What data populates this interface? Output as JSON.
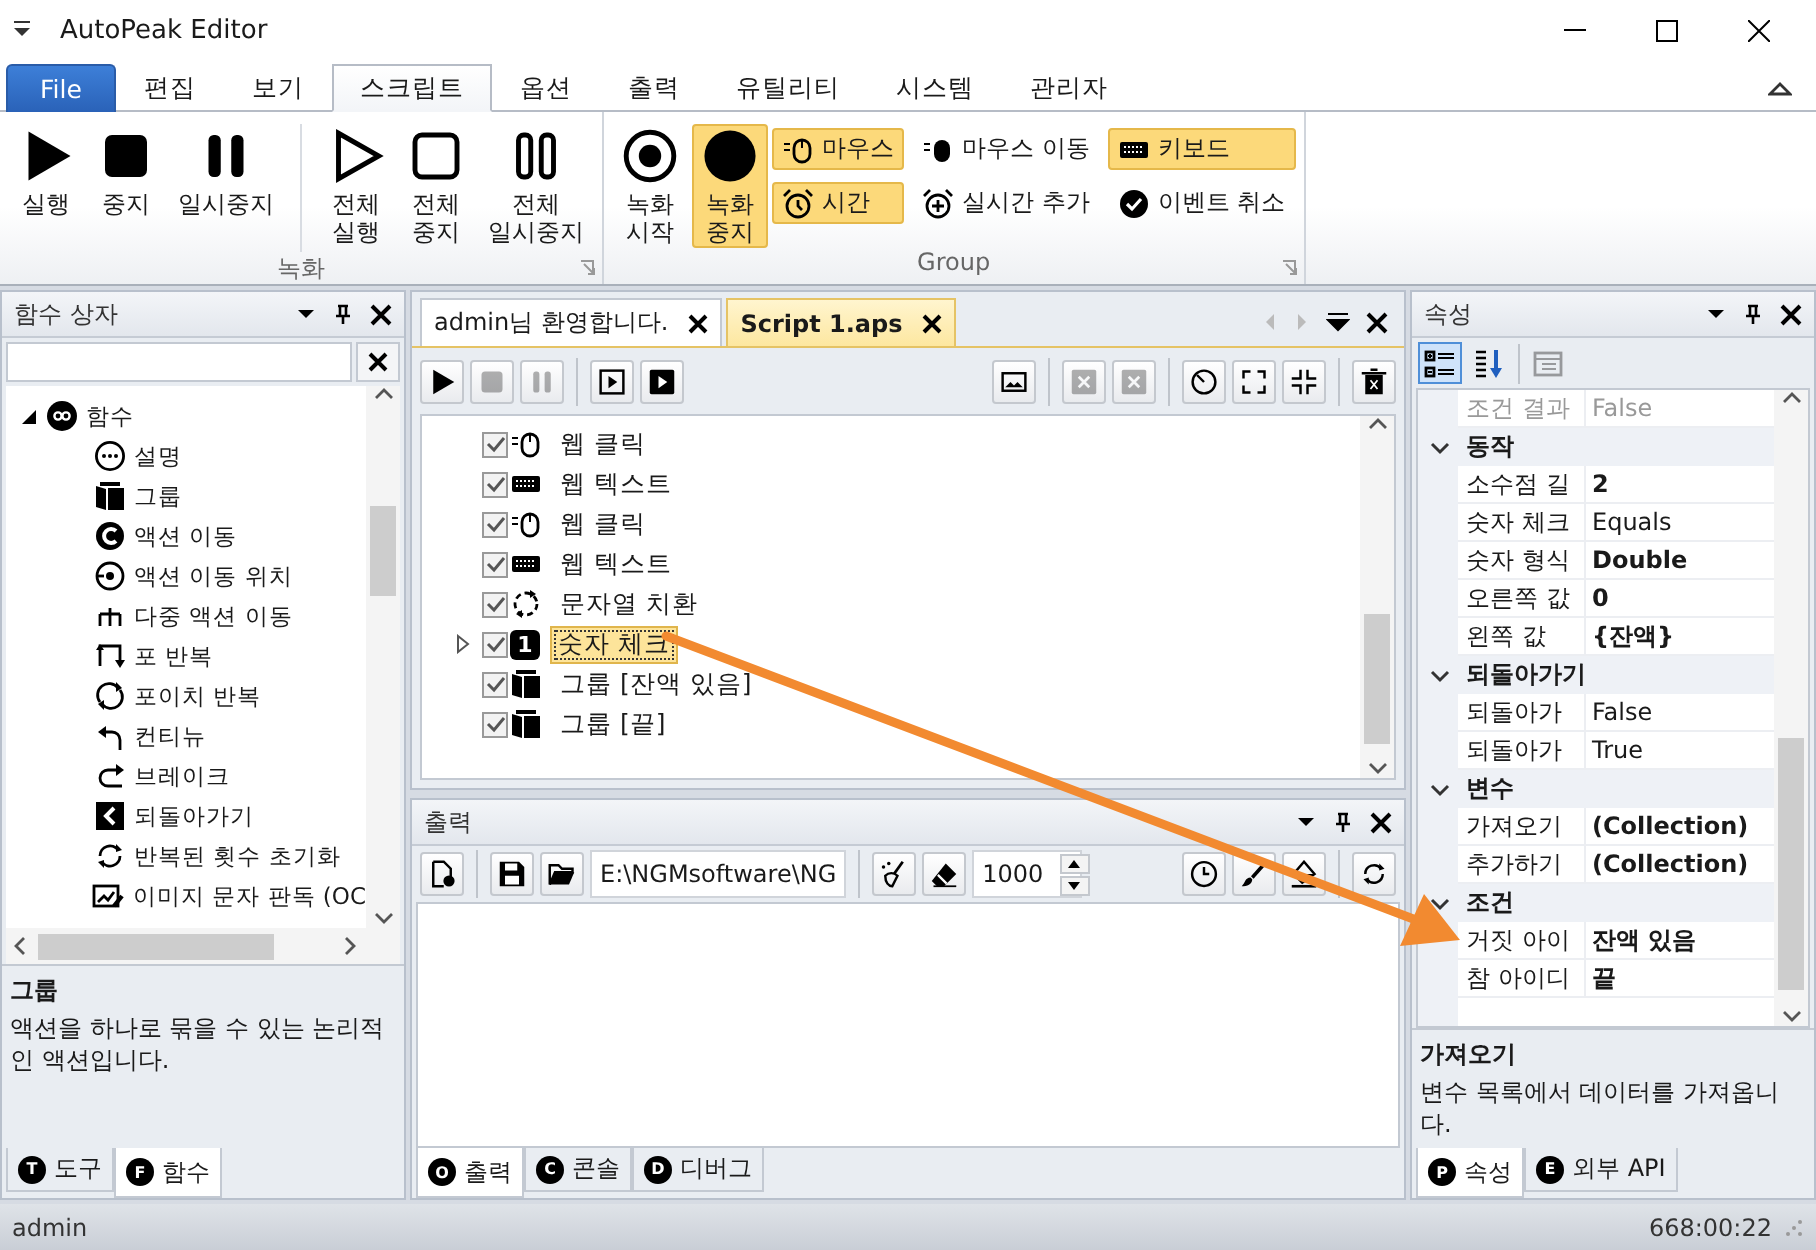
{
  "window": {
    "title": "AutoPeak Editor"
  },
  "ribbon_tabs": [
    {
      "label": "File",
      "kind": "file",
      "selected": false
    },
    {
      "label": "편집",
      "kind": "tab",
      "selected": false
    },
    {
      "label": "보기",
      "kind": "tab",
      "selected": false
    },
    {
      "label": "스크립트",
      "kind": "tab",
      "selected": true
    },
    {
      "label": "옵션",
      "kind": "tab",
      "selected": false
    },
    {
      "label": "출력",
      "kind": "tab",
      "selected": false
    },
    {
      "label": "유틸리티",
      "kind": "tab",
      "selected": false
    },
    {
      "label": "시스템",
      "kind": "tab",
      "selected": false
    },
    {
      "label": "관리자",
      "kind": "tab",
      "selected": false
    }
  ],
  "ribbon_groups": [
    {
      "title": "녹화",
      "items": [
        {
          "kind": "play",
          "label": "실행"
        },
        {
          "kind": "stop",
          "label": "중지"
        },
        {
          "kind": "pause",
          "label": "일시중지"
        },
        {
          "kind": "separator"
        },
        {
          "kind": "play_all",
          "label": "전체\n실행"
        },
        {
          "kind": "stop_all",
          "label": "전체\n중지"
        },
        {
          "kind": "pause_all",
          "label": "전체\n일시중지"
        }
      ]
    },
    {
      "title": "Group",
      "items": [
        {
          "kind": "record",
          "label": "녹화\n시작",
          "on": false
        },
        {
          "kind": "record_stop",
          "label": "녹화\n중지",
          "on": true
        }
      ],
      "small_items": [
        {
          "kind": "mouse",
          "label": "마우스",
          "on": true
        },
        {
          "kind": "mouse_move",
          "label": "마우스 이동",
          "on": false
        },
        {
          "kind": "keyboard",
          "label": "키보드",
          "on": true
        },
        {
          "kind": "alarm",
          "label": "시간",
          "on": true
        },
        {
          "kind": "alarm_add",
          "label": "실시간 추가",
          "on": false
        },
        {
          "kind": "cancel",
          "label": "이벤트 취소",
          "on": false
        }
      ]
    }
  ],
  "function_box": {
    "title": "함수 상자",
    "tree": [
      {
        "kind": "infinity",
        "label": "함수",
        "expanded": true,
        "children": [
          {
            "kind": "desc",
            "label": "설명"
          },
          {
            "kind": "group",
            "label": "그룹"
          },
          {
            "kind": "goto",
            "label": "액션 이동"
          },
          {
            "kind": "goto_pos",
            "label": "액션 이동 위치"
          },
          {
            "kind": "multi",
            "label": "다중 액션 이동"
          },
          {
            "kind": "for",
            "label": "포 반복"
          },
          {
            "kind": "foreach",
            "label": "포이치 반복"
          },
          {
            "kind": "continue",
            "label": "컨티뉴"
          },
          {
            "kind": "break",
            "label": "브레이크"
          },
          {
            "kind": "return",
            "label": "되돌아가기"
          },
          {
            "kind": "reset",
            "label": "반복된 횟수 초기화"
          },
          {
            "kind": "ocr",
            "label": "이미지 문자 판독 (OC"
          }
        ]
      }
    ],
    "description": {
      "title": "그룹",
      "text": "액션을 하나로 묶을 수 있는 논리적인 액션입니다."
    },
    "tabs": [
      {
        "badge": "T",
        "label": "도구",
        "selected": false
      },
      {
        "badge": "F",
        "label": "함수",
        "selected": true
      }
    ]
  },
  "document_tabs": [
    {
      "label": "admin님 환영합니다.",
      "selected": false
    },
    {
      "label": "Script 1.aps",
      "selected": true
    }
  ],
  "editor_toolbar": [
    {
      "kind": "play",
      "disabled": false
    },
    {
      "kind": "stop",
      "disabled": true
    },
    {
      "kind": "pause",
      "disabled": true
    },
    {
      "kind": "separator"
    },
    {
      "kind": "play_box",
      "disabled": false
    },
    {
      "kind": "play_filled",
      "disabled": false
    },
    {
      "kind": "spacer"
    },
    {
      "kind": "image",
      "disabled": false
    },
    {
      "kind": "separator"
    },
    {
      "kind": "close_box",
      "disabled": true
    },
    {
      "kind": "close_box",
      "disabled": true
    },
    {
      "kind": "separator"
    },
    {
      "kind": "timer",
      "disabled": false
    },
    {
      "kind": "expand",
      "disabled": false
    },
    {
      "kind": "collapse",
      "disabled": false
    },
    {
      "kind": "separator"
    },
    {
      "kind": "trash",
      "disabled": false
    }
  ],
  "script_rows": [
    {
      "kind": "web_click",
      "label": "웹 클릭",
      "checked": true,
      "selected": false,
      "expandable": false
    },
    {
      "kind": "web_text",
      "label": "웹 텍스트",
      "checked": true,
      "selected": false,
      "expandable": false
    },
    {
      "kind": "web_click",
      "label": "웹 클릭",
      "checked": true,
      "selected": false,
      "expandable": false
    },
    {
      "kind": "web_text",
      "label": "웹 텍스트",
      "checked": true,
      "selected": false,
      "expandable": false
    },
    {
      "kind": "replace",
      "label": "문자열 치환",
      "checked": true,
      "selected": false,
      "expandable": false
    },
    {
      "kind": "number",
      "badge": "1",
      "label": "숫자 체크",
      "checked": true,
      "selected": true,
      "expandable": true
    },
    {
      "kind": "group",
      "label": "그룹 [잔액 있음]",
      "checked": true,
      "selected": false,
      "expandable": false
    },
    {
      "kind": "group",
      "label": "그룹 [끝]",
      "checked": true,
      "selected": false,
      "expandable": false
    }
  ],
  "output": {
    "title": "출력",
    "toolbar": [
      {
        "kind": "new_file"
      },
      {
        "kind": "separator"
      },
      {
        "kind": "save"
      },
      {
        "kind": "open"
      },
      {
        "kind": "path_field"
      },
      {
        "kind": "separator"
      },
      {
        "kind": "broom"
      },
      {
        "kind": "eraser"
      },
      {
        "kind": "number_field"
      },
      {
        "kind": "spacer"
      },
      {
        "kind": "clock"
      },
      {
        "kind": "brush"
      },
      {
        "kind": "bucket"
      },
      {
        "kind": "separator"
      },
      {
        "kind": "refresh"
      }
    ],
    "path": "E:\\NGMsoftware\\NG",
    "count": "1000",
    "tabs": [
      {
        "badge": "O",
        "label": "출력",
        "selected": true
      },
      {
        "badge": "C",
        "label": "콘솔",
        "selected": false
      },
      {
        "badge": "D",
        "label": "디버그",
        "selected": false
      }
    ]
  },
  "properties": {
    "title": "속성",
    "toolbar": [
      {
        "kind": "categorized",
        "selected": true,
        "disabled": false
      },
      {
        "kind": "alphabetical",
        "selected": false,
        "disabled": false
      },
      {
        "kind": "separator"
      },
      {
        "kind": "pages",
        "selected": false,
        "disabled": true
      }
    ],
    "loose_rows": [
      {
        "name": "조건 결과",
        "value": "False",
        "disabled": true,
        "modified": false
      }
    ],
    "categories": [
      {
        "name": "동작",
        "expanded": true,
        "rows": [
          {
            "name": "소수점 길",
            "value": "2",
            "disabled": false,
            "modified": true
          },
          {
            "name": "숫자 체크",
            "value": "Equals",
            "disabled": false,
            "modified": false
          },
          {
            "name": "숫자 형식",
            "value": "Double",
            "disabled": false,
            "modified": true
          },
          {
            "name": "오른쪽 값",
            "value": "0",
            "disabled": false,
            "modified": true
          },
          {
            "name": "왼쪽 값",
            "value": "{잔액}",
            "disabled": false,
            "modified": true
          }
        ]
      },
      {
        "name": "되돌아가기",
        "expanded": true,
        "rows": [
          {
            "name": "되돌아가",
            "value": "False",
            "disabled": false,
            "modified": false
          },
          {
            "name": "되돌아가",
            "value": "True",
            "disabled": false,
            "modified": false
          }
        ]
      },
      {
        "name": "변수",
        "expanded": true,
        "rows": [
          {
            "name": "가져오기",
            "value": "(Collection)",
            "disabled": false,
            "modified": true
          },
          {
            "name": "추가하기",
            "value": "(Collection)",
            "disabled": false,
            "modified": true
          }
        ]
      },
      {
        "name": "조건",
        "expanded": true,
        "rows": [
          {
            "name": "거짓 아이",
            "value": "잔액 있음",
            "disabled": false,
            "modified": true
          },
          {
            "name": "참 아이디",
            "value": "끝",
            "disabled": false,
            "modified": true
          }
        ]
      }
    ],
    "description": {
      "title": "가져오기",
      "text": "변수 목록에서 데이터를 가져옵니다."
    },
    "tabs": [
      {
        "badge": "P",
        "label": "속성",
        "selected": true
      },
      {
        "badge": "E",
        "label": "외부 API",
        "selected": false
      }
    ]
  },
  "status_bar": {
    "user": "admin",
    "time": "668:00:22"
  }
}
